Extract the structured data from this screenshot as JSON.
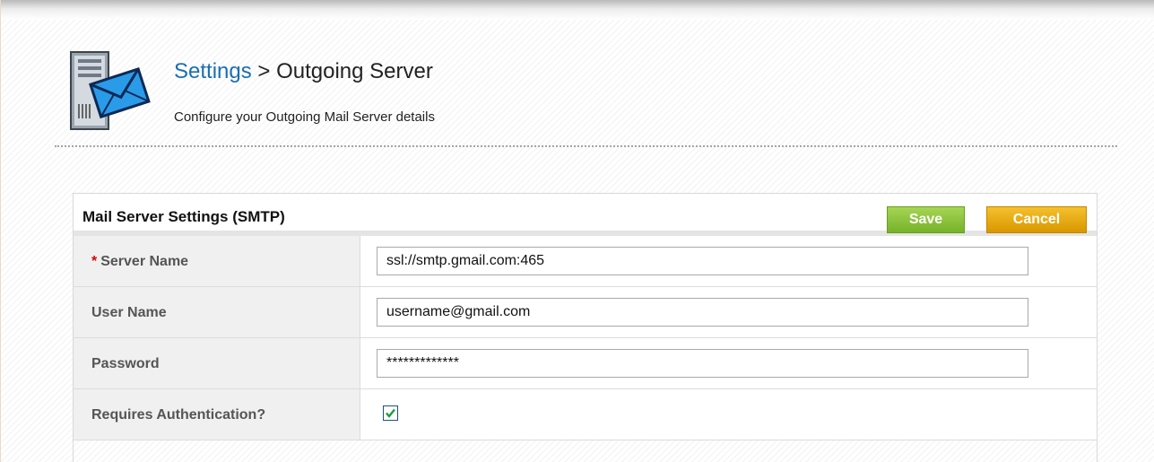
{
  "header": {
    "breadcrumb_link": "Settings",
    "breadcrumb_separator": ">",
    "breadcrumb_current": "Outgoing Server",
    "subtitle": "Configure your Outgoing Mail Server details",
    "icon": "mail-server-icon"
  },
  "panel": {
    "title": "Mail Server Settings (SMTP)",
    "save_label": "Save",
    "cancel_label": "Cancel"
  },
  "form": {
    "server_name": {
      "required_marker": "*",
      "label": "Server Name",
      "value": "ssl://smtp.gmail.com:465"
    },
    "user_name": {
      "label": "User Name",
      "value": "username@gmail.com"
    },
    "password": {
      "label": "Password",
      "value": "*************"
    },
    "requires_auth": {
      "label": "Requires Authentication?",
      "checked": true
    }
  },
  "colors": {
    "link": "#1b6eb4",
    "save": "#8cc63f",
    "cancel": "#e6a800",
    "required": "#dd0000"
  }
}
